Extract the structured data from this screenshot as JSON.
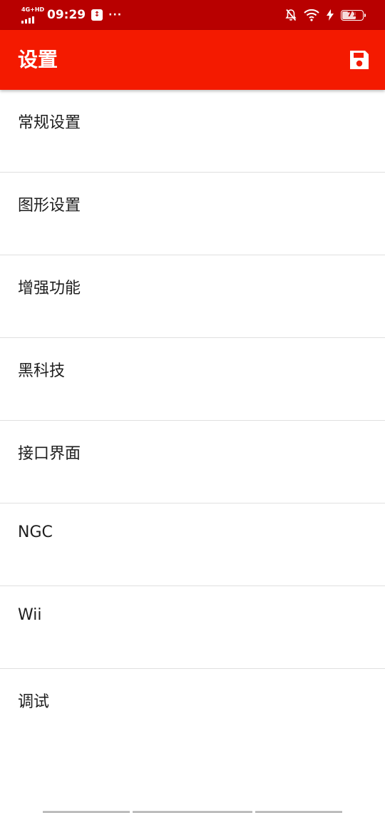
{
  "status_bar": {
    "network_label": "4G+HD",
    "time": "09:29",
    "usb_label": "↕",
    "more": "···",
    "battery_level": "71",
    "battery_fraction": 0.71
  },
  "app_bar": {
    "title": "设置"
  },
  "menu": {
    "items": [
      {
        "label": "常规设置"
      },
      {
        "label": "图形设置"
      },
      {
        "label": "增强功能"
      },
      {
        "label": "黑科技"
      },
      {
        "label": "接口界面"
      },
      {
        "label": "NGC"
      },
      {
        "label": "Wii"
      },
      {
        "label": "调试"
      }
    ]
  },
  "colors": {
    "status_bar": "#b80000",
    "app_bar": "#f41a00",
    "text": "#1e1e1e",
    "divider": "#e0e0e0"
  }
}
